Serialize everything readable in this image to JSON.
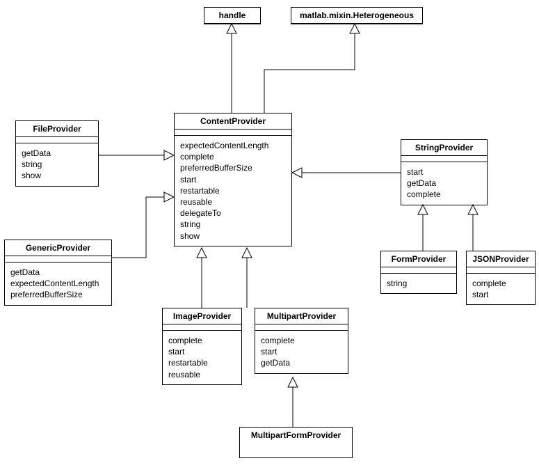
{
  "classes": {
    "handle": {
      "name": "handle",
      "attrs": [],
      "ops": []
    },
    "heterogeneous": {
      "name": "matlab.mixin.Heterogeneous",
      "attrs": [],
      "ops": []
    },
    "contentProvider": {
      "name": "ContentProvider",
      "attrs": [],
      "ops": [
        "expectedContentLength",
        "complete",
        "preferredBufferSize",
        "start",
        "restartable",
        "reusable",
        "delegateTo",
        "string",
        "show"
      ]
    },
    "fileProvider": {
      "name": "FileProvider",
      "attrs": [],
      "ops": [
        "getData",
        "string",
        "show"
      ]
    },
    "genericProvider": {
      "name": "GenericProvider",
      "attrs": [],
      "ops": [
        "getData",
        "expectedContentLength",
        "preferredBufferSize"
      ]
    },
    "imageProvider": {
      "name": "ImageProvider",
      "attrs": [],
      "ops": [
        "complete",
        "start",
        "restartable",
        "reusable"
      ]
    },
    "multipartProvider": {
      "name": "MultipartProvider",
      "attrs": [],
      "ops": [
        "complete",
        "start",
        "getData"
      ]
    },
    "multipartFormProvider": {
      "name": "MultipartFormProvider",
      "attrs": [],
      "ops": []
    },
    "stringProvider": {
      "name": "StringProvider",
      "attrs": [],
      "ops": [
        "start",
        "getData",
        "complete"
      ]
    },
    "formProvider": {
      "name": "FormProvider",
      "attrs": [],
      "ops": [
        "string"
      ]
    },
    "jsonProvider": {
      "name": "JSONProvider",
      "attrs": [],
      "ops": [
        "complete",
        "start"
      ]
    }
  },
  "inheritance": [
    {
      "from": "contentProvider",
      "to": "handle"
    },
    {
      "from": "contentProvider",
      "to": "heterogeneous"
    },
    {
      "from": "fileProvider",
      "to": "contentProvider"
    },
    {
      "from": "genericProvider",
      "to": "contentProvider"
    },
    {
      "from": "stringProvider",
      "to": "contentProvider"
    },
    {
      "from": "imageProvider",
      "to": "contentProvider"
    },
    {
      "from": "multipartProvider",
      "to": "contentProvider"
    },
    {
      "from": "multipartFormProvider",
      "to": "multipartProvider"
    },
    {
      "from": "formProvider",
      "to": "stringProvider"
    },
    {
      "from": "jsonProvider",
      "to": "stringProvider"
    }
  ]
}
